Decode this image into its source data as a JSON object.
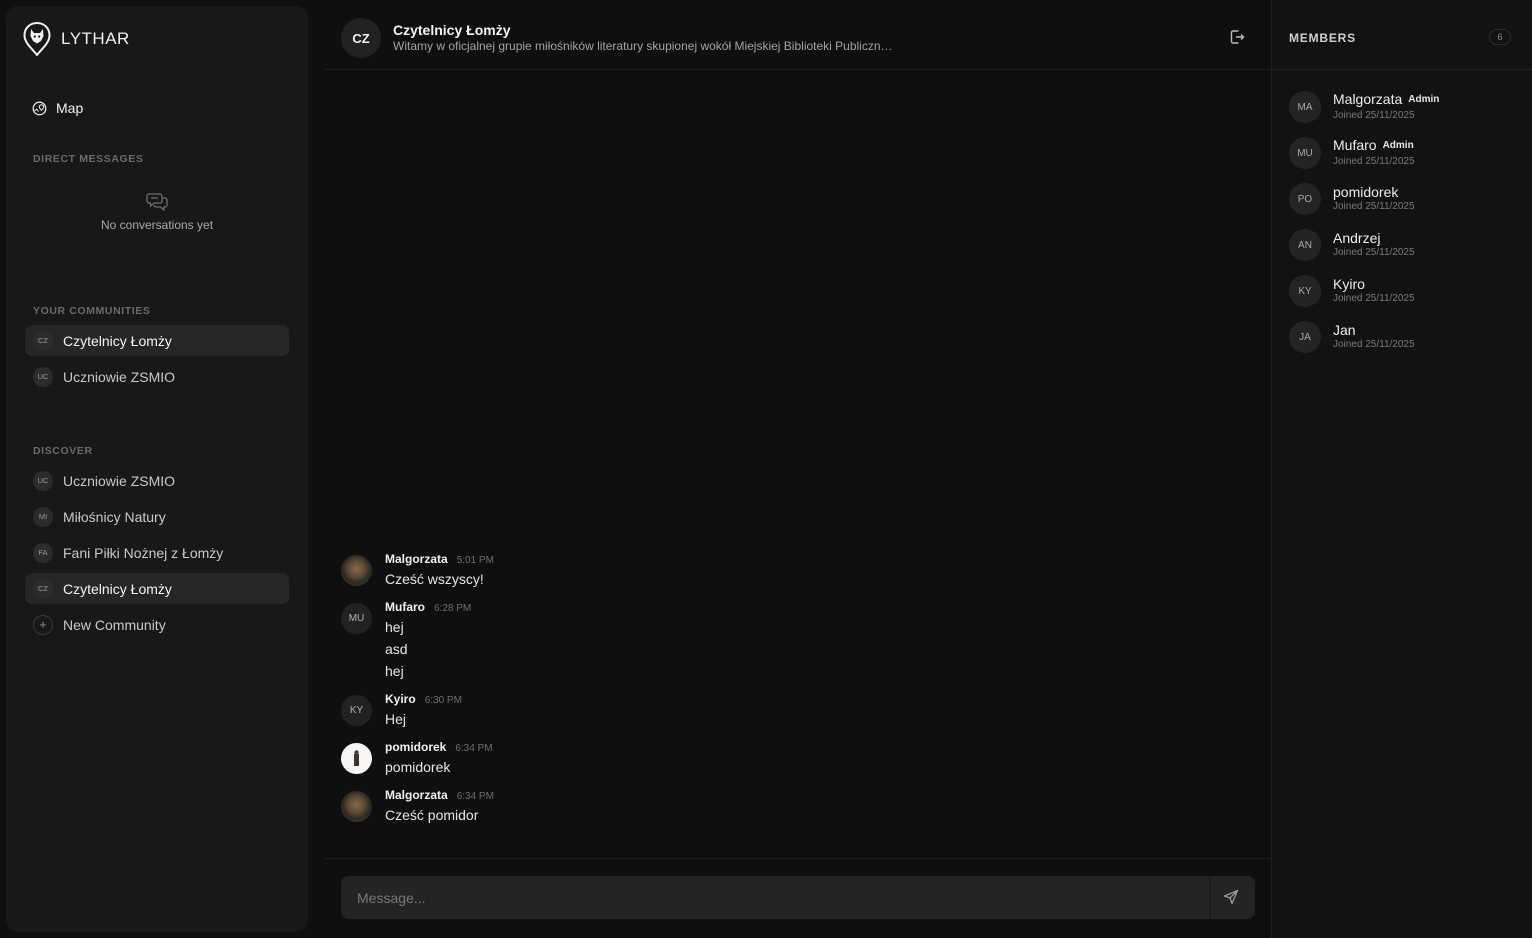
{
  "brand": {
    "name": "LYTHAR",
    "icon": "wolf-pin-logo-icon"
  },
  "sidebar": {
    "map_label": "Map",
    "dm_section": "DIRECT MESSAGES",
    "dm_empty": "No conversations yet",
    "communities_section": "YOUR COMMUNITIES",
    "communities": [
      {
        "initials": "CZ",
        "label": "Czytelnicy Łomży",
        "active": true
      },
      {
        "initials": "UC",
        "label": "Uczniowie ZSMIO",
        "active": false
      }
    ],
    "discover_section": "DISCOVER",
    "discover": [
      {
        "initials": "UC",
        "label": "Uczniowie ZSMIO",
        "active": false
      },
      {
        "initials": "MI",
        "label": "Miłośnicy Natury",
        "active": false
      },
      {
        "initials": "FA",
        "label": "Fani Piłki Nożnej z Łomży",
        "active": false
      },
      {
        "initials": "CZ",
        "label": "Czytelnicy Łomży",
        "active": true
      }
    ],
    "new_community_label": "New Community"
  },
  "chat": {
    "avatar_initials": "CZ",
    "title": "Czytelnicy Łomży",
    "description": "Witamy w oficjalnej grupie miłośników literatury skupionej wokół Miejskiej Biblioteki Publiczn…",
    "composer_placeholder": "Message...",
    "messages": [
      {
        "author": "Malgorzata",
        "time": "5:01 PM",
        "avatar": "photo",
        "lines": [
          "Cześć wszyscy!"
        ]
      },
      {
        "author": "Mufaro",
        "time": "6:28 PM",
        "avatar_initials": "MU",
        "lines": [
          "hej",
          "asd",
          "hej"
        ]
      },
      {
        "author": "Kyiro",
        "time": "6:30 PM",
        "avatar_initials": "KY",
        "lines": [
          "Hej"
        ]
      },
      {
        "author": "pomidorek",
        "time": "6:34 PM",
        "avatar": "photo-white",
        "lines": [
          "pomidorek"
        ]
      },
      {
        "author": "Malgorzata",
        "time": "6:34 PM",
        "avatar": "photo",
        "lines": [
          "Cześć pomidor"
        ]
      }
    ]
  },
  "members": {
    "title": "MEMBERS",
    "count": "6",
    "list": [
      {
        "initials": "MA",
        "name": "Malgorzata",
        "badge": "Admin",
        "joined": "Joined 25/11/2025"
      },
      {
        "initials": "MU",
        "name": "Mufaro",
        "badge": "Admin",
        "joined": "Joined 25/11/2025"
      },
      {
        "initials": "PO",
        "name": "pomidorek",
        "badge": "",
        "joined": "Joined 25/11/2025"
      },
      {
        "initials": "AN",
        "name": "Andrzej",
        "badge": "",
        "joined": "Joined 25/11/2025"
      },
      {
        "initials": "KY",
        "name": "Kyiro",
        "badge": "",
        "joined": "Joined 25/11/2025"
      },
      {
        "initials": "JA",
        "name": "Jan",
        "badge": "",
        "joined": "Joined 25/11/2025"
      }
    ]
  },
  "colors": {
    "background": "#0f0f0f",
    "sidebar": "#181818",
    "active_item": "#262626",
    "composer": "#242424"
  }
}
